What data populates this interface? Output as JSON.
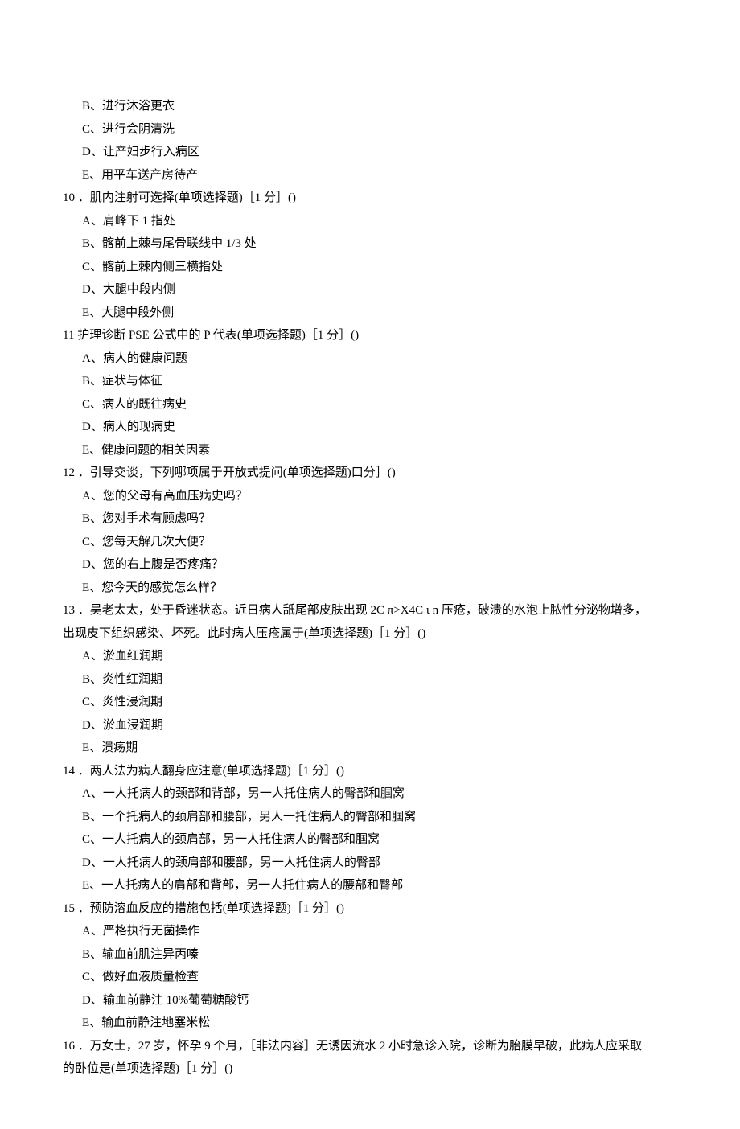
{
  "lines": [
    {
      "cls": "option",
      "text": "B、进行沐浴更衣"
    },
    {
      "cls": "option",
      "text": "C、进行会阴清洗"
    },
    {
      "cls": "option",
      "text": "D、让产妇步行入病区"
    },
    {
      "cls": "option",
      "text": "E、用平车送产房待产"
    },
    {
      "cls": "question-stem",
      "text": "10 ．肌内注射可选择(单项选择题)［1 分］()"
    },
    {
      "cls": "option",
      "text": "A、肩峰下 1 指处"
    },
    {
      "cls": "option",
      "text": "B、髂前上棘与尾骨联线中 1/3 处"
    },
    {
      "cls": "option",
      "text": "C、髂前上棘内侧三横指处"
    },
    {
      "cls": "option",
      "text": "D、大腿中段内侧"
    },
    {
      "cls": "option",
      "text": "E、大腿中段外侧"
    },
    {
      "cls": "question-stem",
      "text": "11 护理诊断 PSE 公式中的 P 代表(单项选择题)［1 分］()"
    },
    {
      "cls": "option",
      "text": "A、病人的健康问题"
    },
    {
      "cls": "option",
      "text": "B、症状与体征"
    },
    {
      "cls": "option",
      "text": "C、病人的既往病史"
    },
    {
      "cls": "option",
      "text": "D、病人的现病史"
    },
    {
      "cls": "option",
      "text": "E、健康问题的相关因素"
    },
    {
      "cls": "question-stem",
      "text": "12 ．引导交谈，下列哪项属于开放式提问(单项选择题)口分］()"
    },
    {
      "cls": "option",
      "text": "A、您的父母有高血压病史吗？"
    },
    {
      "cls": "option",
      "text": "B、您对手术有顾虑吗？"
    },
    {
      "cls": "option",
      "text": "C、您每天解几次大便？"
    },
    {
      "cls": "option",
      "text": "D、您的右上腹是否疼痛？"
    },
    {
      "cls": "option",
      "text": "E、您今天的感觉怎么样？"
    },
    {
      "cls": "question-stem",
      "text": "13 ．吴老太太，处于昏迷状态。近日病人舐尾部皮肤出现 2C π>X4C ι n 压疮，破溃的水泡上脓性分泌物增多，"
    },
    {
      "cls": "question-stem-cont",
      "text": "出现皮下组织感染、坏死。此时病人压疮属于(单项选择题)［1 分］()"
    },
    {
      "cls": "option",
      "text": "A、淤血红润期"
    },
    {
      "cls": "option",
      "text": "B、炎性红润期"
    },
    {
      "cls": "option",
      "text": "C、炎性浸润期"
    },
    {
      "cls": "option",
      "text": "D、淤血浸润期"
    },
    {
      "cls": "option",
      "text": "E、溃疡期"
    },
    {
      "cls": "question-stem",
      "text": "14 ．两人法为病人翻身应注意(单项选择题)［1 分］()"
    },
    {
      "cls": "option",
      "text": "A、一人托病人的颈部和背部，另一人托住病人的臀部和腘窝"
    },
    {
      "cls": "option",
      "text": "B、一个托病人的颈肩部和腰部，另人一托住病人的臀部和腘窝"
    },
    {
      "cls": "option",
      "text": "C、一人托病人的颈肩部，另一人托住病人的臀部和腘窝"
    },
    {
      "cls": "option",
      "text": "D、一人托病人的颈肩部和腰部，另一人托住病人的臀部"
    },
    {
      "cls": "option",
      "text": "E、一人托病人的肩部和背部，另一人托住病人的腰部和臀部"
    },
    {
      "cls": "question-stem",
      "text": "15 ．预防溶血反应的措施包括(单项选择题)［1 分］()"
    },
    {
      "cls": "option",
      "text": "A、严格执行无菌操作"
    },
    {
      "cls": "option",
      "text": "B、输血前肌注异丙嗪"
    },
    {
      "cls": "option",
      "text": "C、做好血液质量检查"
    },
    {
      "cls": "option",
      "text": "D、输血前静注 10%葡萄糖酸钙"
    },
    {
      "cls": "option",
      "text": "E、输血前静注地塞米松"
    },
    {
      "cls": "question-stem",
      "text": "16 ．万女士，27 岁，怀孕 9 个月，［非法内容］无诱因流水 2 小时急诊入院，诊断为胎膜早破，此病人应采取"
    },
    {
      "cls": "question-stem-cont",
      "text": "的卧位是(单项选择题)［1 分］()"
    }
  ]
}
